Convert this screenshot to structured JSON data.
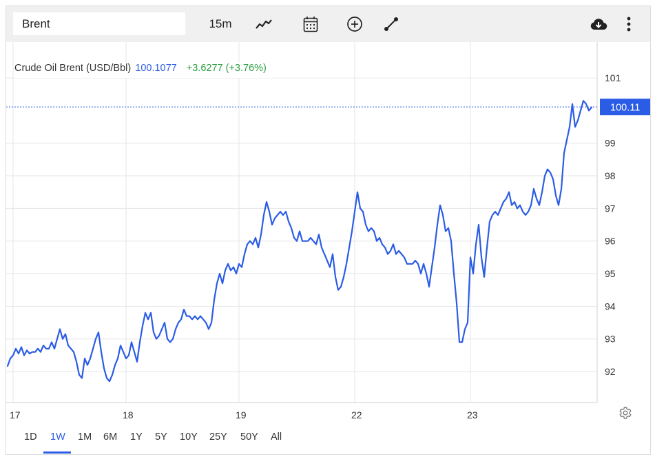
{
  "toolbar": {
    "symbol_value": "Brent",
    "interval_label": "15m",
    "icons": [
      "line-chart-icon",
      "calendar-icon",
      "plus-circle-icon",
      "draw-line-icon",
      "cloud-download-icon",
      "more-vertical-icon"
    ]
  },
  "legend": {
    "name": "Crude Oil Brent (USD/Bbl)",
    "price": "100.1077",
    "change": "+3.6277 (+3.76%)"
  },
  "current_price_label": "100.11",
  "colors": {
    "line": "#2b5ce6",
    "price_tag_bg": "#2b5ce6",
    "change_positive": "#2ea043",
    "grid": "#e6e6e6",
    "toolbar_bg": "#f0f0f0"
  },
  "periods": {
    "items": [
      "1D",
      "1W",
      "1M",
      "6M",
      "1Y",
      "5Y",
      "10Y",
      "25Y",
      "50Y",
      "All"
    ],
    "active": "1W"
  },
  "chart_data": {
    "type": "line",
    "title": "",
    "xlabel": "",
    "ylabel": "",
    "x_ticks": [
      "17",
      "18",
      "19",
      "22",
      "23"
    ],
    "y_ticks": [
      92,
      93,
      94,
      95,
      96,
      97,
      98,
      99,
      101
    ],
    "ylim": [
      91.05,
      102.1
    ],
    "grid": true,
    "y_axis_side": "right",
    "current_value": 100.11,
    "series": [
      {
        "values": [
          92.17,
          92.4,
          92.5,
          92.7,
          92.55,
          92.75,
          92.5,
          92.65,
          92.55,
          92.6,
          92.6,
          92.7,
          92.6,
          92.8,
          92.7,
          92.7,
          92.9,
          92.7,
          93.0,
          93.3,
          93.0,
          93.15,
          92.8,
          92.7,
          92.6,
          92.3,
          91.9,
          91.8,
          92.4,
          92.2,
          92.4,
          92.7,
          93.0,
          93.2,
          92.6,
          92.1,
          91.8,
          91.7,
          91.9,
          92.2,
          92.4,
          92.8,
          92.6,
          92.4,
          92.5,
          92.9,
          92.6,
          92.3,
          92.9,
          93.4,
          93.8,
          93.6,
          93.8,
          93.2,
          93.0,
          93.1,
          93.3,
          93.5,
          93.0,
          92.9,
          93.0,
          93.3,
          93.5,
          93.6,
          93.9,
          93.7,
          93.7,
          93.6,
          93.7,
          93.6,
          93.7,
          93.6,
          93.5,
          93.3,
          93.5,
          94.2,
          94.7,
          95.0,
          94.7,
          95.1,
          95.3,
          95.1,
          95.2,
          95.0,
          95.3,
          95.2,
          95.6,
          95.9,
          96.0,
          95.9,
          96.1,
          95.8,
          96.2,
          96.8,
          97.2,
          96.9,
          96.5,
          96.7,
          96.8,
          96.9,
          96.8,
          96.9,
          96.6,
          96.4,
          96.1,
          96.0,
          96.3,
          96.0,
          96.0,
          96.0,
          96.1,
          96.0,
          95.9,
          96.2,
          95.8,
          95.6,
          95.4,
          95.2,
          95.6,
          94.9,
          94.5,
          94.6,
          94.9,
          95.3,
          95.8,
          96.3,
          96.9,
          97.5,
          97.0,
          96.9,
          96.5,
          96.3,
          96.4,
          96.3,
          96.0,
          96.1,
          95.9,
          95.8,
          95.6,
          95.7,
          95.9,
          95.6,
          95.7,
          95.6,
          95.5,
          95.3,
          95.3,
          95.3,
          95.4,
          95.3,
          95.0,
          95.3,
          95.0,
          94.6,
          95.2,
          95.8,
          96.5,
          97.1,
          96.8,
          96.3,
          96.4,
          96.0,
          95.0,
          94.1,
          92.9,
          92.9,
          93.3,
          93.5,
          95.5,
          95.0,
          95.9,
          96.5,
          95.5,
          94.9,
          95.8,
          96.6,
          96.8,
          96.9,
          96.8,
          97.0,
          97.2,
          97.3,
          97.5,
          97.1,
          97.2,
          97.0,
          97.1,
          96.9,
          96.8,
          96.9,
          97.1,
          97.6,
          97.3,
          97.1,
          97.5,
          98.0,
          98.2,
          98.1,
          97.9,
          97.4,
          97.1,
          97.6,
          98.7,
          99.1,
          99.5,
          100.2,
          99.5,
          99.7,
          100.0,
          100.3,
          100.2,
          100.0,
          100.1
        ]
      }
    ]
  }
}
